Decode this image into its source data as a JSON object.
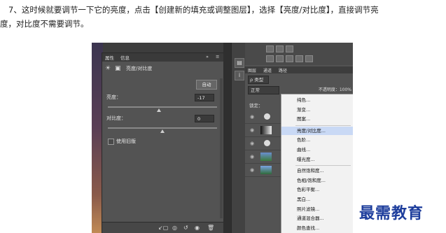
{
  "instruction": {
    "line1": "7、这时候就要调节一下它的亮度，点击【创建新的填充或调整图层】，选择【亮度/对比度】，直接调节亮",
    "line2": "度，对比度不需要调节。"
  },
  "properties": {
    "tabs": [
      "属性",
      "信息"
    ],
    "title": "亮度/对比度",
    "auto_label": "自动",
    "brightness_label": "亮度：",
    "brightness_value": "-17",
    "brightness_level": 0.47,
    "contrast_label": "对比度：",
    "contrast_value": "0",
    "contrast_level": 0.5,
    "legacy_label": "使用旧版"
  },
  "layers": {
    "tabs": [
      "图层",
      "通道",
      "路径"
    ],
    "filter_label": "ρ 类型",
    "blend_mode": "正常",
    "opacity": "不透明度：100%",
    "lock_label": "锁定："
  },
  "menu": {
    "items": [
      "纯色...",
      "渐变...",
      "图案...",
      "亮度/对比度...",
      "色阶...",
      "曲线...",
      "曝光度...",
      "自然饱和度...",
      "色相/饱和度...",
      "色彩平衡...",
      "黑白...",
      "照片滤镜...",
      "通道混合器...",
      "颜色查找..."
    ],
    "highlighted": "亮度/对比度..."
  },
  "watermark": "最需教育",
  "colors": {
    "panel": "#535353",
    "menu_bg": "#f2f2f2",
    "highlight": "#c9d9f5",
    "watermark": "#1d3d9c"
  }
}
